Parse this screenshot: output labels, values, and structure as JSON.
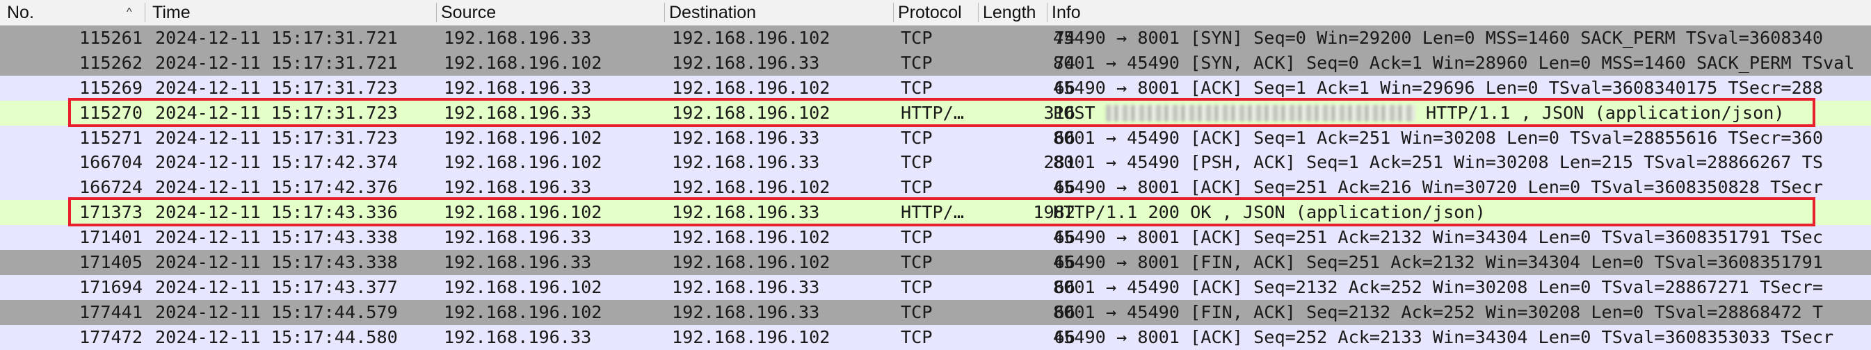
{
  "columns": {
    "no": "No.",
    "time": "Time",
    "source": "Source",
    "destination": "Destination",
    "protocol": "Protocol",
    "length": "Length",
    "info": "Info"
  },
  "packets": [
    {
      "no": "115261",
      "time": "2024-12-11 15:17:31.721",
      "source": "192.168.196.33",
      "destination": "192.168.196.102",
      "protocol": "TCP",
      "length": "74",
      "info": "45490 → 8001 [SYN] Seq=0 Win=29200 Len=0 MSS=1460 SACK_PERM TSval=3608340",
      "style": "gray"
    },
    {
      "no": "115262",
      "time": "2024-12-11 15:17:31.721",
      "source": "192.168.196.102",
      "destination": "192.168.196.33",
      "protocol": "TCP",
      "length": "74",
      "info": "8001 → 45490 [SYN, ACK] Seq=0 Ack=1 Win=28960 Len=0 MSS=1460 SACK_PERM TSval",
      "style": "gray"
    },
    {
      "no": "115269",
      "time": "2024-12-11 15:17:31.723",
      "source": "192.168.196.33",
      "destination": "192.168.196.102",
      "protocol": "TCP",
      "length": "66",
      "info": "45490 → 8001 [ACK] Seq=1 Ack=1 Win=29696 Len=0 TSval=3608340175 TSecr=288",
      "style": "lav"
    },
    {
      "no": "115270",
      "time": "2024-12-11 15:17:31.723",
      "source": "192.168.196.33",
      "destination": "192.168.196.102",
      "protocol": "HTTP/…",
      "length": "316",
      "info_prefix": "POST ",
      "info": " HTTP/1.1 , JSON (application/json)",
      "redacted": true,
      "style": "green"
    },
    {
      "no": "115271",
      "time": "2024-12-11 15:17:31.723",
      "source": "192.168.196.102",
      "destination": "192.168.196.33",
      "protocol": "TCP",
      "length": "66",
      "info": "8001 → 45490 [ACK] Seq=1 Ack=251 Win=30208 Len=0 TSval=28855616 TSecr=360",
      "style": "lav"
    },
    {
      "no": "166704",
      "time": "2024-12-11 15:17:42.374",
      "source": "192.168.196.102",
      "destination": "192.168.196.33",
      "protocol": "TCP",
      "length": "281",
      "info": "8001 → 45490 [PSH, ACK] Seq=1 Ack=251 Win=30208 Len=215 TSval=28866267 TS",
      "style": "lav"
    },
    {
      "no": "166724",
      "time": "2024-12-11 15:17:42.376",
      "source": "192.168.196.33",
      "destination": "192.168.196.102",
      "protocol": "TCP",
      "length": "66",
      "info": "45490 → 8001 [ACK] Seq=251 Ack=216 Win=30720 Len=0 TSval=3608350828 TSecr",
      "style": "lav"
    },
    {
      "no": "171373",
      "time": "2024-12-11 15:17:43.336",
      "source": "192.168.196.102",
      "destination": "192.168.196.33",
      "protocol": "HTTP/…",
      "length": "1982",
      "info": "HTTP/1.1 200 OK , JSON (application/json)",
      "style": "green"
    },
    {
      "no": "171401",
      "time": "2024-12-11 15:17:43.338",
      "source": "192.168.196.33",
      "destination": "192.168.196.102",
      "protocol": "TCP",
      "length": "66",
      "info": "45490 → 8001 [ACK] Seq=251 Ack=2132 Win=34304 Len=0 TSval=3608351791 TSec",
      "style": "lav"
    },
    {
      "no": "171405",
      "time": "2024-12-11 15:17:43.338",
      "source": "192.168.196.33",
      "destination": "192.168.196.102",
      "protocol": "TCP",
      "length": "66",
      "info": "45490 → 8001 [FIN, ACK] Seq=251 Ack=2132 Win=34304 Len=0 TSval=3608351791",
      "style": "gray"
    },
    {
      "no": "171694",
      "time": "2024-12-11 15:17:43.377",
      "source": "192.168.196.102",
      "destination": "192.168.196.33",
      "protocol": "TCP",
      "length": "66",
      "info": "8001 → 45490 [ACK] Seq=2132 Ack=252 Win=30208 Len=0 TSval=28867271 TSecr=",
      "style": "lav"
    },
    {
      "no": "177441",
      "time": "2024-12-11 15:17:44.579",
      "source": "192.168.196.102",
      "destination": "192.168.196.33",
      "protocol": "TCP",
      "length": "66",
      "info": "8001 → 45490 [FIN, ACK] Seq=2132 Ack=252 Win=30208 Len=0 TSval=28868472 T",
      "style": "gray"
    },
    {
      "no": "177472",
      "time": "2024-12-11 15:17:44.580",
      "source": "192.168.196.33",
      "destination": "192.168.196.102",
      "protocol": "TCP",
      "length": "66",
      "info": "45490 → 8001 [ACK] Seq=252 Ack=2133 Win=34304 Len=0 TSval=3608353033 TSecr",
      "style": "lav"
    }
  ],
  "highlighted_packets": [
    "115270",
    "171373"
  ],
  "colors": {
    "gray_row": "#a6a6a6",
    "lavender_row": "#e7e6ff",
    "green_row": "#e4ffc7",
    "highlight_box": "#e8202b"
  },
  "sort": {
    "column": "no",
    "icon": "sort-ascending-icon"
  }
}
